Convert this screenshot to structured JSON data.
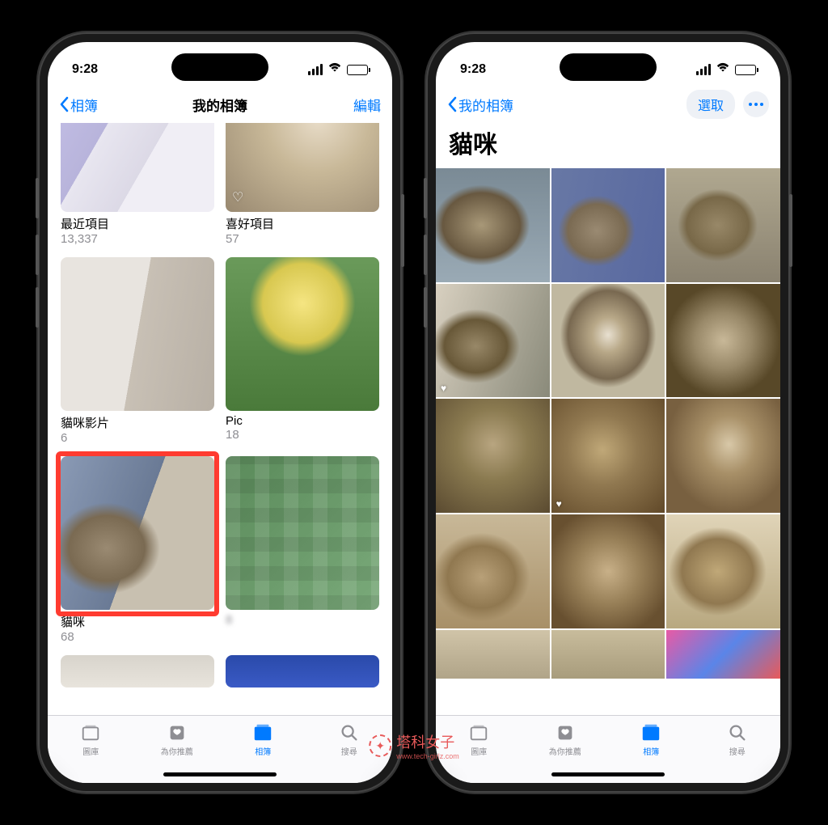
{
  "status": {
    "time": "9:28"
  },
  "left": {
    "nav": {
      "back": "相簿",
      "title": "我的相簿",
      "edit": "編輯"
    },
    "albums": [
      {
        "name": "最近項目",
        "count": "13,337",
        "thumb": "th-recent",
        "fav": false
      },
      {
        "name": "喜好項目",
        "count": "57",
        "thumb": "th-fav",
        "fav": true
      },
      {
        "name": "貓咪影片",
        "count": "6",
        "thumb": "th-cat-video",
        "fav": false
      },
      {
        "name": "Pic",
        "count": "18",
        "thumb": "th-pic",
        "fav": false
      },
      {
        "name": "貓咪",
        "count": "68",
        "thumb": "th-cat",
        "fav": false,
        "highlight": true
      },
      {
        "name": "",
        "count": "8",
        "thumb": "th-blur",
        "fav": false
      }
    ]
  },
  "right": {
    "nav": {
      "back": "我的相簿",
      "select": "選取"
    },
    "title": "貓咪"
  },
  "tabs": {
    "library": "圖庫",
    "foryou": "為你推薦",
    "albums": "相簿",
    "search": "搜尋"
  },
  "watermark": {
    "text": "塔科女子",
    "sub": "www.tech-girlz.com"
  }
}
